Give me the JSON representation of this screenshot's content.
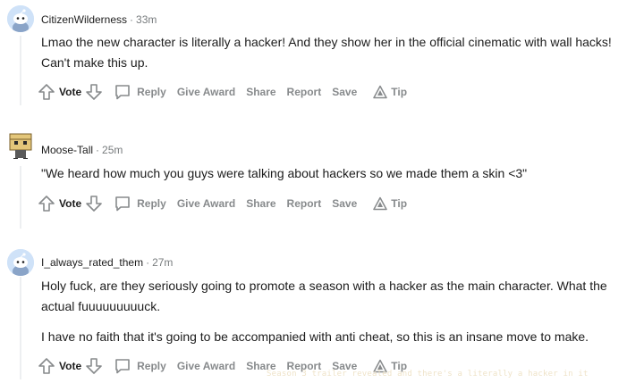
{
  "comments": [
    {
      "username": "CitizenWilderness",
      "separator": "·",
      "time": "33m",
      "avatar": "reddit-snoo-blue",
      "paragraphs": [
        "Lmao the new character is literally a hacker! And they show her in the official cinematic with wall hacks! Can't make this up."
      ]
    },
    {
      "username": "Moose-Tall",
      "separator": "·",
      "time": "25m",
      "avatar": "custom-box-character",
      "paragraphs": [
        "\"We heard how much you guys were talking about hackers so we made them a skin <3\""
      ]
    },
    {
      "username": "I_always_rated_them",
      "separator": "·",
      "time": "27m",
      "avatar": "reddit-snoo-blue",
      "paragraphs": [
        "Holy fuck, are they seriously going to promote a season with a hacker as the main character. What the actual fuuuuuuuuuck.",
        "I have no faith that it's going to be accompanied with anti cheat, so this is an insane move to make."
      ]
    }
  ],
  "actions": {
    "vote": "Vote",
    "reply": "Reply",
    "give_award": "Give Award",
    "share": "Share",
    "report": "Report",
    "save": "Save",
    "tip": "Tip"
  },
  "watermark": "Season 3 trailer revealed and there's a literally a hacker in it",
  "colors": {
    "meta_gray": "#787c7e",
    "action_gray": "#878a8c",
    "text": "#1c1c1c",
    "avatar_bg": "#cfe2f8"
  }
}
